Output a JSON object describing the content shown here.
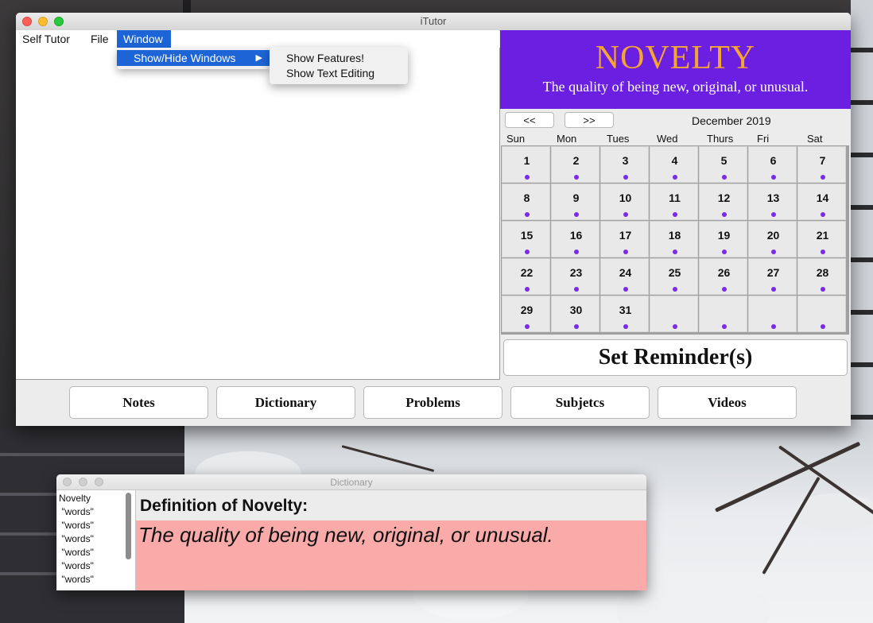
{
  "window": {
    "title": "iTutor",
    "menus": [
      "Self Tutor",
      "File",
      "Window"
    ],
    "window_menu": {
      "item": "Show/Hide Windows",
      "submenu": [
        "Show Features!",
        "Show Text Editing"
      ]
    }
  },
  "word_of_day": {
    "word": "NOVELTY",
    "definition": "The quality of being new, original, or unusual."
  },
  "calendar": {
    "prev_label": "<<",
    "next_label": ">>",
    "month": "December 2019",
    "days_of_week": [
      "Sun",
      "Mon",
      "Tues",
      "Wed",
      "Thurs",
      "Fri",
      "Sat"
    ],
    "days": [
      "1",
      "2",
      "3",
      "4",
      "5",
      "6",
      "7",
      "8",
      "9",
      "10",
      "11",
      "12",
      "13",
      "14",
      "15",
      "16",
      "17",
      "18",
      "19",
      "20",
      "21",
      "22",
      "23",
      "24",
      "25",
      "26",
      "27",
      "28",
      "29",
      "30",
      "31",
      "",
      "",
      "",
      ""
    ],
    "dot_color": "#7a2be8"
  },
  "reminder_label": "Set Reminder(s)",
  "toolbar": [
    "Notes",
    "Dictionary",
    "Problems",
    "Subjetcs",
    "Videos"
  ],
  "dictionary": {
    "title": "Dictionary",
    "list": [
      "Novelty",
      " \"words\"",
      " \"words\"",
      " \"words\"",
      " \"words\"",
      " \"words\"",
      " \"words\""
    ],
    "heading": "Definition of Novelty:",
    "definition": "The quality of being new, original, or unusual."
  },
  "colors": {
    "accent_menu": "#1d64d6",
    "word_banner": "#6b1fe0",
    "word_text": "#f5a531",
    "definition_bg": "#fbaaaa"
  }
}
